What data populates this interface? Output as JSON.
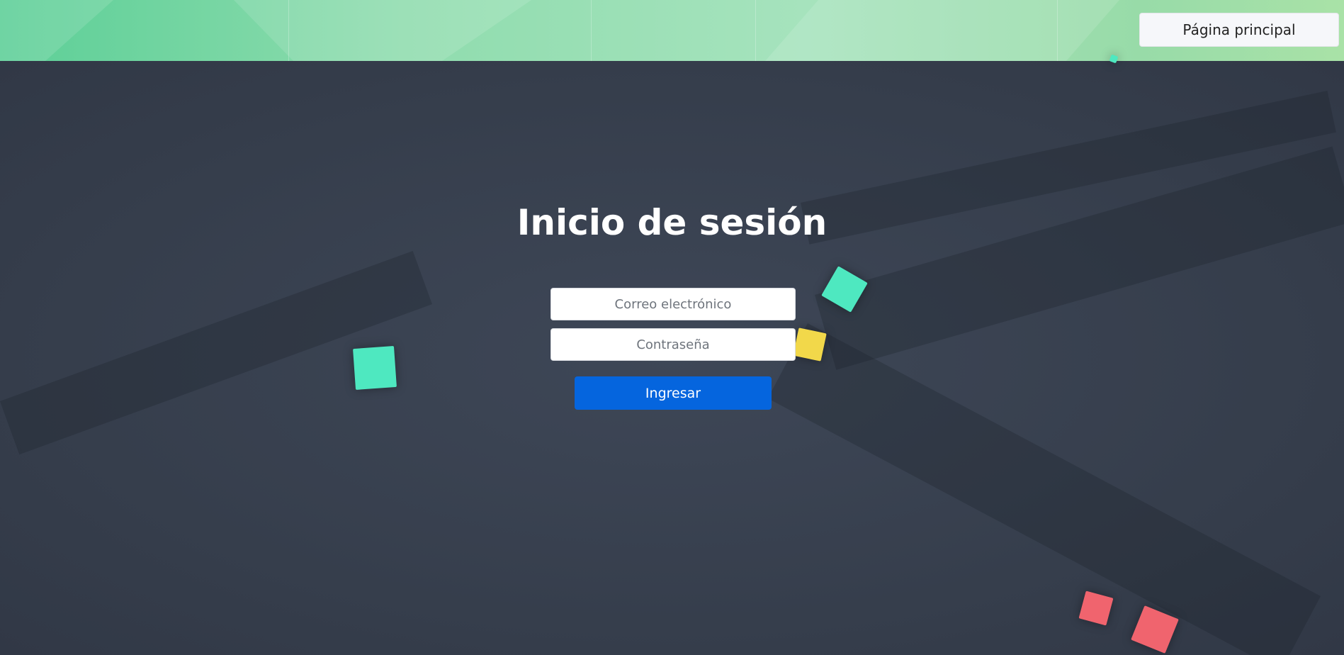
{
  "header": {
    "home_button_label": "Página principal"
  },
  "login": {
    "title": "Inicio de sesión",
    "email_placeholder": "Correo electrónico",
    "password_placeholder": "Contraseña",
    "submit_label": "Ingresar"
  },
  "colors": {
    "header_green": "#8fdcae",
    "background": "#3a4352",
    "primary_button": "#0565de",
    "square_teal": "#4ee8c0",
    "square_yellow": "#f2d84a",
    "square_red": "#f0646e"
  }
}
